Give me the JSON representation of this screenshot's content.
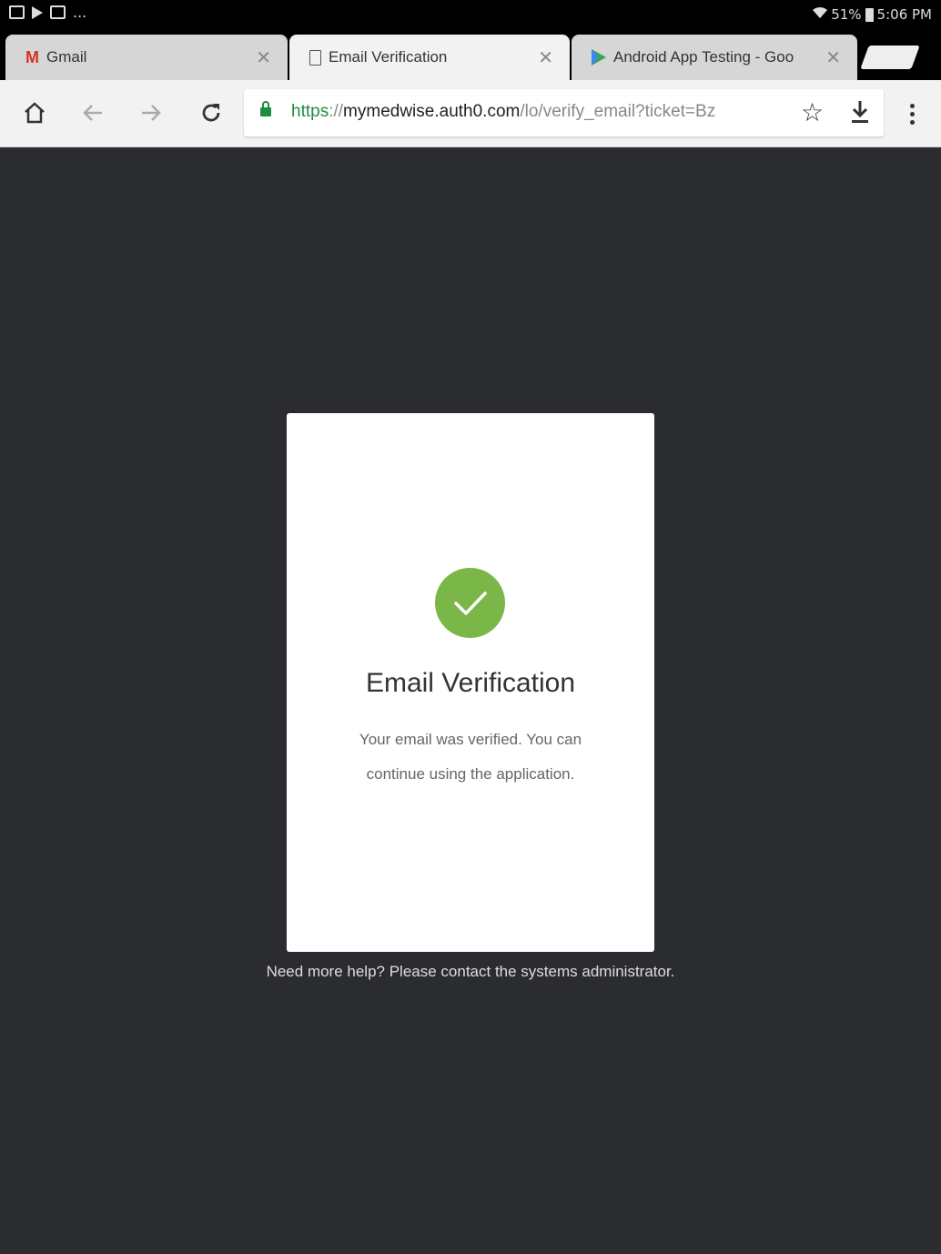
{
  "status_bar": {
    "left_dots": "...",
    "right_text": "51% ",
    "time": "5:06 PM"
  },
  "tabs": [
    {
      "title": "Gmail",
      "icon": "gmail-icon",
      "active": false
    },
    {
      "title": "Email Verification",
      "icon": "page-icon",
      "active": true
    },
    {
      "title": "Android App Testing - Goo",
      "icon": "play-store-icon",
      "active": false
    }
  ],
  "tab_close_glyph": "✕",
  "toolbar": {
    "url_scheme": "https",
    "url_sep": "://",
    "url_host": "mymedwise.auth0.com",
    "url_path": "/lo/verify_email?ticket=Bz"
  },
  "card": {
    "title": "Email Verification",
    "message": "Your email was verified. You can continue using the application.",
    "check_color": "#7ab648"
  },
  "help_text": "Need more help? Please contact the systems administrator."
}
